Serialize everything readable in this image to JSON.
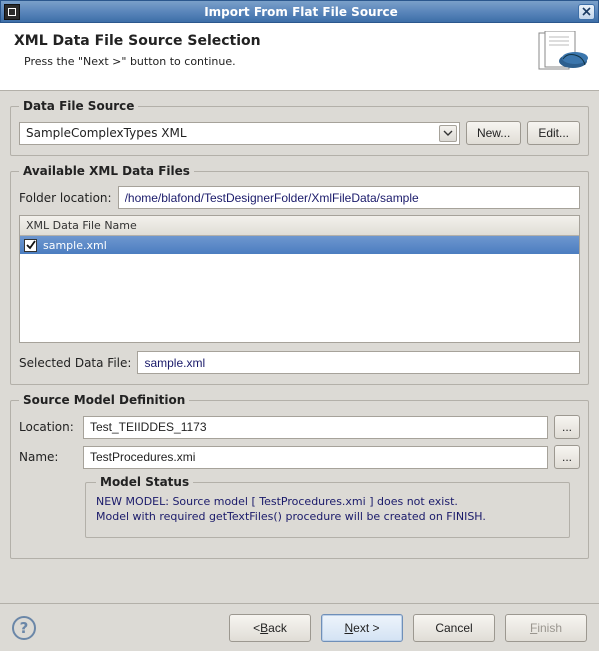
{
  "window": {
    "title": "Import From Flat File Source"
  },
  "header": {
    "title": "XML Data File Source Selection",
    "subtitle": "Press the \"Next >\" button to continue."
  },
  "data_file_source": {
    "legend": "Data File Source",
    "selected": "SampleComplexTypes XML",
    "new_label": "New...",
    "edit_label": "Edit..."
  },
  "available": {
    "legend": "Available XML Data Files",
    "folder_label": "Folder location:",
    "folder_value": "/home/blafond/TestDesignerFolder/XmlFileData/sample",
    "column_header": "XML Data File Name",
    "rows": [
      {
        "checked": true,
        "name": "sample.xml"
      }
    ],
    "selected_label": "Selected Data File:",
    "selected_value": "sample.xml"
  },
  "smd": {
    "legend": "Source Model Definition",
    "location_label": "Location:",
    "location_value": "Test_TEIIDDES_1173",
    "name_label": "Name:",
    "name_value": "TestProcedures.xmi",
    "browse_label": "...",
    "status_legend": "Model Status",
    "status_line1": "NEW MODEL: Source model [ TestProcedures.xmi ] does not exist.",
    "status_line2": "Model with required getTextFiles() procedure will be created on FINISH."
  },
  "buttons": {
    "back": "< Back",
    "next": "Next >",
    "cancel": "Cancel",
    "finish": "Finish"
  }
}
